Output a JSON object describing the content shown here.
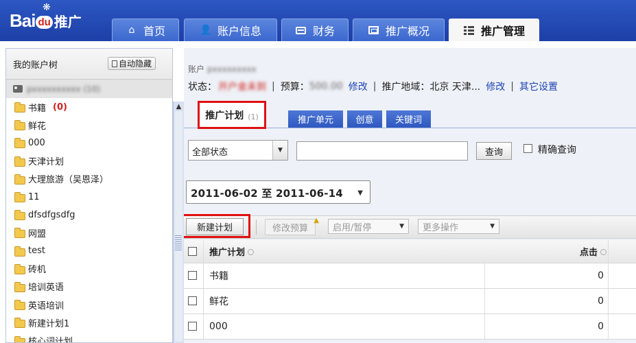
{
  "header": {
    "logo_text_bai": "Bai",
    "logo_text_du": "du",
    "logo_suffix": "推广",
    "nav": [
      {
        "label": "首页",
        "icon": "home-icon"
      },
      {
        "label": "账户信息",
        "icon": "user-icon"
      },
      {
        "label": "财务",
        "icon": "card-icon"
      },
      {
        "label": "推广概况",
        "icon": "screen-icon"
      },
      {
        "label": "推广管理",
        "icon": "list-icon",
        "active": true
      }
    ]
  },
  "sidebar": {
    "title": "我的账户树",
    "autohide_label": "自动隐藏",
    "account_name": "pxxxxxxxxxx (10)",
    "items": [
      {
        "label": "书籍",
        "count": "(0)"
      },
      {
        "label": "鲜花"
      },
      {
        "label": "000"
      },
      {
        "label": "天津计划"
      },
      {
        "label": "大理旅游（吴恩泽）"
      },
      {
        "label": "11"
      },
      {
        "label": "dfsdfgsdfg"
      },
      {
        "label": "网盟"
      },
      {
        "label": "test"
      },
      {
        "label": "砖机"
      },
      {
        "label": "培训英语"
      },
      {
        "label": "英语培训"
      },
      {
        "label": "新建计划1"
      },
      {
        "label": "核心词计划"
      }
    ]
  },
  "main": {
    "account_label": "账户",
    "account_value": "pxxxxxxxxx",
    "status_label": "状态：",
    "status_value": "开户金未到",
    "budget_label": "预算：",
    "budget_value": "500.00",
    "modify1": "修改",
    "region_label": "推广地域：北京  天津...",
    "modify2": "修改",
    "other_settings": "其它设置",
    "tabs": {
      "plan": "推广计划",
      "plan_count": "(1)",
      "unit": "推广单元",
      "creative": "创意",
      "keyword": "关键词"
    },
    "filter": {
      "status_selected": "全部状态",
      "search_value": "",
      "search_button": "查询",
      "exact_label": "精确查询"
    },
    "date_range": "2011-06-02 至  2011-06-14",
    "toolbar": {
      "new_plan": "新建计划",
      "edit_budget": "修改预算",
      "enable_pause": "启用/暂停",
      "more_ops": "更多操作"
    },
    "table": {
      "col_name": "推广计划",
      "col_click": "点击",
      "rows": [
        {
          "name": "书籍",
          "clicks": "0"
        },
        {
          "name": "鲜花",
          "clicks": "0"
        },
        {
          "name": "000",
          "clicks": "0"
        }
      ]
    }
  }
}
